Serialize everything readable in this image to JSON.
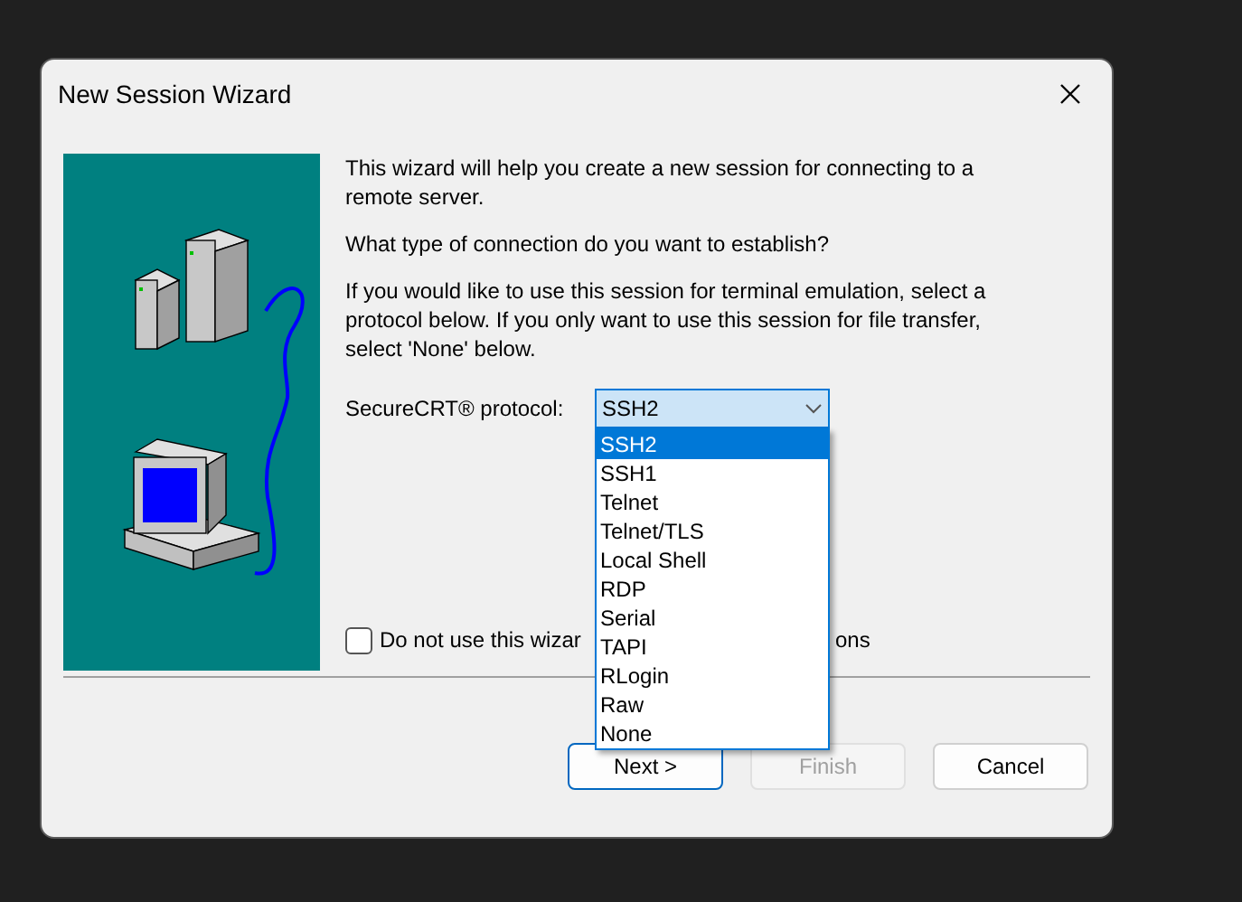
{
  "window": {
    "title": "New Session Wizard"
  },
  "intro": "This wizard will help you create a new session for connecting to a remote server.",
  "question": "What type of connection do you want to establish?",
  "explanation": "If you would like to use this session for terminal emulation, select a protocol below.  If you only want to use this session for file transfer, select 'None' below.",
  "protocol": {
    "label": "SecureCRT® protocol:",
    "value": "SSH2",
    "expanded": true,
    "options": [
      {
        "label": "SSH2",
        "selected": true
      },
      {
        "label": "SSH1",
        "selected": false
      },
      {
        "label": "Telnet",
        "selected": false
      },
      {
        "label": "Telnet/TLS",
        "selected": false
      },
      {
        "label": "Local Shell",
        "selected": false
      },
      {
        "label": "RDP",
        "selected": false
      },
      {
        "label": "Serial",
        "selected": false
      },
      {
        "label": "TAPI",
        "selected": false
      },
      {
        "label": "RLogin",
        "selected": false
      },
      {
        "label": "Raw",
        "selected": false
      },
      {
        "label": "None",
        "selected": false
      }
    ]
  },
  "checkbox": {
    "label_start": "Do not use this wizar",
    "label_end": "ons",
    "checked": false
  },
  "buttons": [
    {
      "label": "Next >",
      "disabled": false,
      "default": true
    },
    {
      "label": "Finish",
      "disabled": true,
      "default": false
    },
    {
      "label": "Cancel",
      "disabled": false,
      "default": false
    }
  ]
}
